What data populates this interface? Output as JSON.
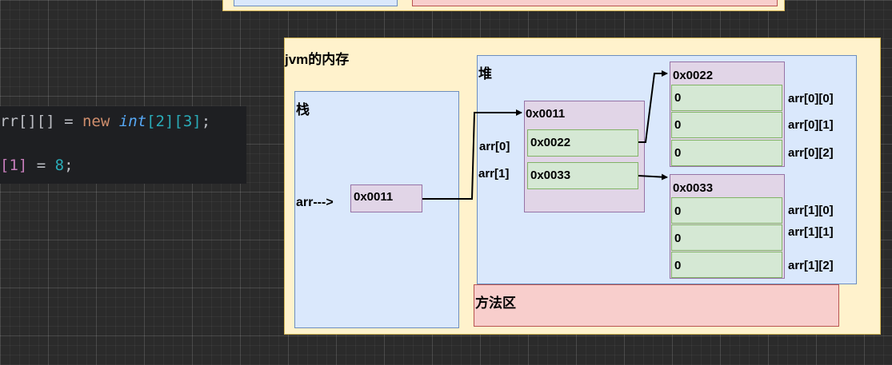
{
  "code": {
    "line1": {
      "ident": "rr[][]",
      "eq": " = ",
      "kw_new": "new",
      "type": "int",
      "dims": "[2][3]",
      "end": ";"
    },
    "line2": {
      "index": "[1]",
      "eq": " = ",
      "value": "8",
      "end": ";"
    }
  },
  "diagram": {
    "title": "jvm的内存",
    "stack": {
      "label": "栈",
      "var_label": "arr--->",
      "var_value": "0x0011"
    },
    "heap": {
      "label": "堆",
      "outer": {
        "address": "0x0011",
        "rows": [
          {
            "label": "arr[0]",
            "value": "0x0022"
          },
          {
            "label": "arr[1]",
            "value": "0x0033"
          }
        ]
      },
      "inner0": {
        "address": "0x0022",
        "rows": [
          {
            "value": "0",
            "label": "arr[0][0]"
          },
          {
            "value": "0",
            "label": "arr[0][1]"
          },
          {
            "value": "0",
            "label": "arr[0][2]"
          }
        ]
      },
      "inner1": {
        "address": "0x0033",
        "rows": [
          {
            "value": "0",
            "label": "arr[1][0]"
          },
          {
            "value": "0",
            "label": "arr[1][1]"
          },
          {
            "value": "0",
            "label": "arr[1][2]"
          }
        ]
      }
    },
    "method_area": {
      "label": "方法区"
    }
  },
  "colors": {
    "background": "#2b2b2b",
    "frame_fill": "#fff2cc",
    "region_fill": "#dae8fc",
    "method_fill": "#f8cecc",
    "object_fill": "#e1d5e7",
    "cell_fill": "#d5e8d4"
  }
}
